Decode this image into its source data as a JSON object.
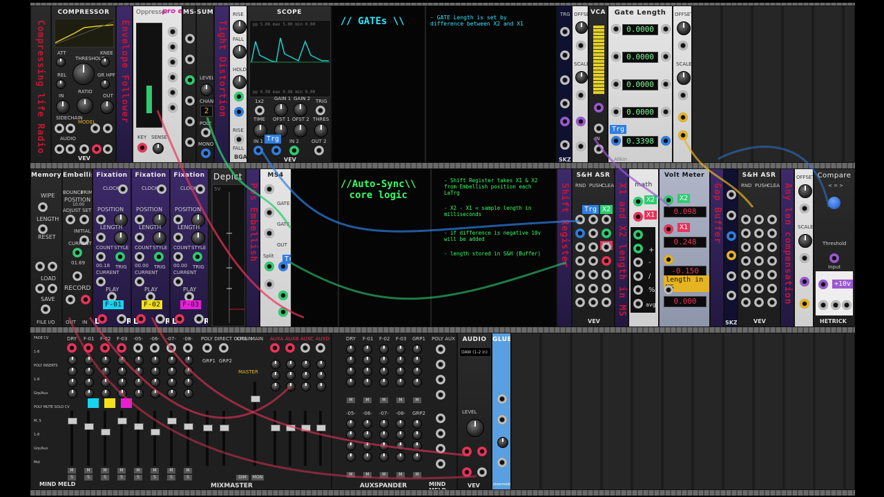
{
  "colors": {
    "cable_green": "#2ecc71",
    "cable_red": "#e8335a",
    "cable_yellow": "#e6b422",
    "cable_blue": "#2f7de1",
    "note_cyan": "#2ee6ff",
    "note_green": "#33ff66"
  },
  "row1": {
    "compressor": {
      "title": "COMPRESSOR",
      "vertical": "Compressing life Radio",
      "labels": [
        "ATT",
        "THRESHOLD",
        "KNEE",
        "REL",
        "GR HPF",
        "IN",
        "RATIO",
        "OUT",
        "SIDECHAIN",
        "AUDIO",
        "L/MON",
        "RIGHT",
        "MODEL",
        "THRES",
        "AUTO MAKEUP",
        "GR",
        "LEFT",
        "RIGHT"
      ],
      "brand": "VEV"
    },
    "vertical2": "Envelope Follower",
    "oppressor": {
      "title": "Oppressor",
      "badge": "pro env",
      "labels": [
        "KEY",
        "SENSE"
      ]
    },
    "ms4": {
      "title": "MS4"
    },
    "sum": {
      "title": "SUM",
      "labels": [
        "LEVEL",
        "CHAN",
        "POLY",
        "MONO"
      ],
      "chan": "2"
    },
    "vertical3": "Tight Distortion",
    "rise": {
      "labels": [
        "RISE",
        "FALL",
        "HOLD",
        "RISE",
        "FALL"
      ],
      "brand": "BGA"
    },
    "scope": {
      "title": "SCOPE",
      "top_readout": "pp  5.00  max  5.00  min  0.00",
      "bottom_readout": "pp  0.98  max  0.98  min  0.00",
      "labels": [
        "1x2",
        "GAIN 1",
        "GAIN 2",
        "TRIG",
        "TIME",
        "OFST 1",
        "OFST 2",
        "THRES",
        "IN 1",
        "X 1",
        "IN 2",
        "OUT 2"
      ],
      "brand": "VEV"
    },
    "note_gates": {
      "heading": "// GATEs \\\\",
      "text": "- GATE Length is set by difference between X2 and X1"
    },
    "sshp": {
      "labels": [
        "TRG",
        "ENV",
        "SHP",
        "LVL",
        "IN",
        "OUT",
        "ENV"
      ],
      "brand": "SKZ"
    },
    "offset1": {
      "labels": [
        "OFFSET",
        "CV",
        "SCALE",
        "CV",
        "IN",
        "OUT"
      ]
    },
    "vca": {
      "title": "VCA",
      "labels": [
        "IN",
        "OUT"
      ]
    },
    "gatelength": {
      "title": "Gate Length",
      "values": [
        "0.0000",
        "0.0000",
        "0.0000",
        "0.0000",
        "0.3398"
      ],
      "footer": "Allkin"
    },
    "offset2": {
      "labels": [
        "OFFSET",
        "CV",
        "SCALE",
        "CV",
        "IN",
        "OUT"
      ]
    }
  },
  "row2": {
    "memory": {
      "title": "Memory",
      "labels": [
        "WIPE",
        "LENGTH",
        "RESET",
        "LOAD",
        "SAVE",
        "FILE I/O",
        "LOG"
      ]
    },
    "embellish": {
      "title": "Embellish",
      "labels": [
        "BOUNCE",
        "PRIME",
        "POSITION",
        "ADJUST",
        "SET",
        "INITIAL",
        "CURRENT",
        "RECORD",
        "OUT",
        "IN"
      ],
      "reading": "10.00",
      "current": "01.69"
    },
    "fixations": [
      {
        "title": "Fixation",
        "labels": [
          "CLOCK",
          "POSITION",
          "LENGTH",
          "COUNT",
          "STYLE",
          "TRIG",
          "CURRENT",
          "PLAY"
        ],
        "count": "00.18",
        "tag": "F-01",
        "tag_color": "#17d3f0"
      },
      {
        "title": "Fixation",
        "labels": [
          "CLOCK",
          "POSITION",
          "LENGTH",
          "COUNT",
          "STYLE",
          "TRIG",
          "CURRENT",
          "PLAY"
        ],
        "count": "00.00",
        "tag": "F-02",
        "tag_color": "#f2e11a"
      },
      {
        "title": "Fixation",
        "labels": [
          "CLOCK",
          "POSITION",
          "LENGTH",
          "COUNT",
          "STYLE",
          "TRIG",
          "CURRENT",
          "PLAY"
        ],
        "count": "00.00",
        "tag": "F-03",
        "tag_color": "#e61fd7"
      }
    ],
    "lr": [
      "L",
      "R"
    ],
    "depict": {
      "title": "Depict",
      "scale": "5V"
    },
    "vertical4": "Pos Embellish",
    "ms4b": {
      "title": "MS4",
      "labels": [
        "GATE",
        "OUT",
        "GATE",
        "INV",
        "OUT",
        "Merge",
        "OUT",
        "Split",
        "GATE",
        "INV",
        "OUT"
      ]
    },
    "trg_tag": "Trg",
    "note_sync": {
      "heading": "//Auto-Sync\\\\\ncore logic",
      "lines": [
        "- Shift Register takes X1 & X2 from Embellish position each LaTrg",
        "- X2 - X1 = sample length in milliseconds",
        "- if difference is negative 10v will be added",
        "- length stored in S&H (Buffer)"
      ]
    },
    "vertical5": "Shift Register",
    "sah1": {
      "title": "S&H ASR",
      "labels": [
        "RND",
        "PUSH",
        "CLEAR",
        "IN",
        "TRIG"
      ],
      "brand": "VEV",
      "tags": [
        "Trg",
        "X2",
        "X1"
      ]
    },
    "vertical6": "X1 and X2 length in MS",
    "math": {
      "title": "math",
      "ops": [
        "+",
        "-",
        "/",
        "%",
        "avg"
      ],
      "tags": [
        "X2",
        "X1"
      ]
    },
    "voltmeter": {
      "title": "Volt Meter",
      "values": [
        "0.098",
        "0.248",
        "-0.150",
        "0.000"
      ],
      "tags": [
        "X2",
        "X1"
      ],
      "note": "length in MS"
    },
    "vertical7": "Gap Buffer",
    "sshp2": {
      "labels": [
        "TRG",
        "IN",
        "OUT",
        "IN",
        "OUT"
      ],
      "brand": "SKZ"
    },
    "sah2": {
      "title": "S&H ASR",
      "labels": [
        "RND",
        "PUSH",
        "CLEAR",
        "IN",
        "TRIG"
      ],
      "brand": "VEV"
    },
    "vertical8": "Any len compensation",
    "offset3": {
      "labels": [
        "OFFSET",
        "CV",
        "SCALE",
        "CV",
        "IN",
        "OUT"
      ]
    },
    "compare": {
      "title": "Compare",
      "sub": "< = >",
      "labels": [
        "Threshold",
        "Input"
      ],
      "tag": "+10v",
      "brand": "HETRICK",
      "ports": [
        "<",
        "=",
        ">",
        "G",
        "T",
        "O"
      ]
    }
  },
  "row3": {
    "mixmaster": {
      "left_labels": [
        "FADE CV",
        "1-8",
        "POLY INSERTS",
        "1-8",
        "Grp/Aux",
        "POLY MUTE SOLO CV",
        "M, S",
        "1-8",
        "Grp/Aux",
        "Mst"
      ],
      "channels": [
        "DRY",
        "F-01",
        "F-02",
        "F-03",
        "-05-",
        "-06-",
        "-07-",
        "-08-"
      ],
      "groups": [
        "GRP1",
        "GRP2"
      ],
      "poly_direct": "POLY DIRECT OUTS",
      "sub_labels": [
        "1-8",
        "Grp/Aux"
      ],
      "chain": "CHAIN",
      "main": "MAIN",
      "master": "MASTER",
      "aux": [
        "AUXA",
        "AUXB",
        "AUXC",
        "AUXD"
      ],
      "brand": "MIXMASTER",
      "maker": "MIND MELD",
      "buttons": [
        "M",
        "S",
        "DIM",
        "MON"
      ]
    },
    "auxspander": {
      "channels_top": [
        "DRY",
        "F-01",
        "F-02",
        "F-03",
        "GRP1"
      ],
      "channels_bottom": [
        "-05-",
        "-06-",
        "-07-",
        "-08-",
        "GRP2"
      ],
      "rows": [
        "A",
        "B",
        "C",
        "D"
      ],
      "side": "AUX SENDS",
      "poly_aux": "POLY AUX CV",
      "aux_groups": [
        "A-B",
        "1-8",
        "C-D",
        "Grps",
        "A-B",
        "1-8",
        "Grps"
      ],
      "bus": [
        "Bus",
        "Snd Pn",
        "Mn",
        "Bus",
        "Rtn",
        "M"
      ],
      "brand": "AUXSPANDER",
      "maker": "MIND MELD"
    },
    "audio": {
      "title": "AUDIO",
      "device": "DAW (1-2 in)",
      "meter": [
        "-3",
        "-6",
        "-12",
        "-18",
        "-24",
        "-36"
      ],
      "labels": [
        "LEVEL",
        "L/MON",
        "RIGHT",
        "LEFT",
        "RIGHT"
      ],
      "brand": "VEV"
    },
    "glue": {
      "title": "GLUE",
      "labels": [
        "LABEL",
        "LOCK",
        "OPACITY",
        "GRABBY",
        "HIDE"
      ],
      "footer": "stoermelder"
    }
  }
}
